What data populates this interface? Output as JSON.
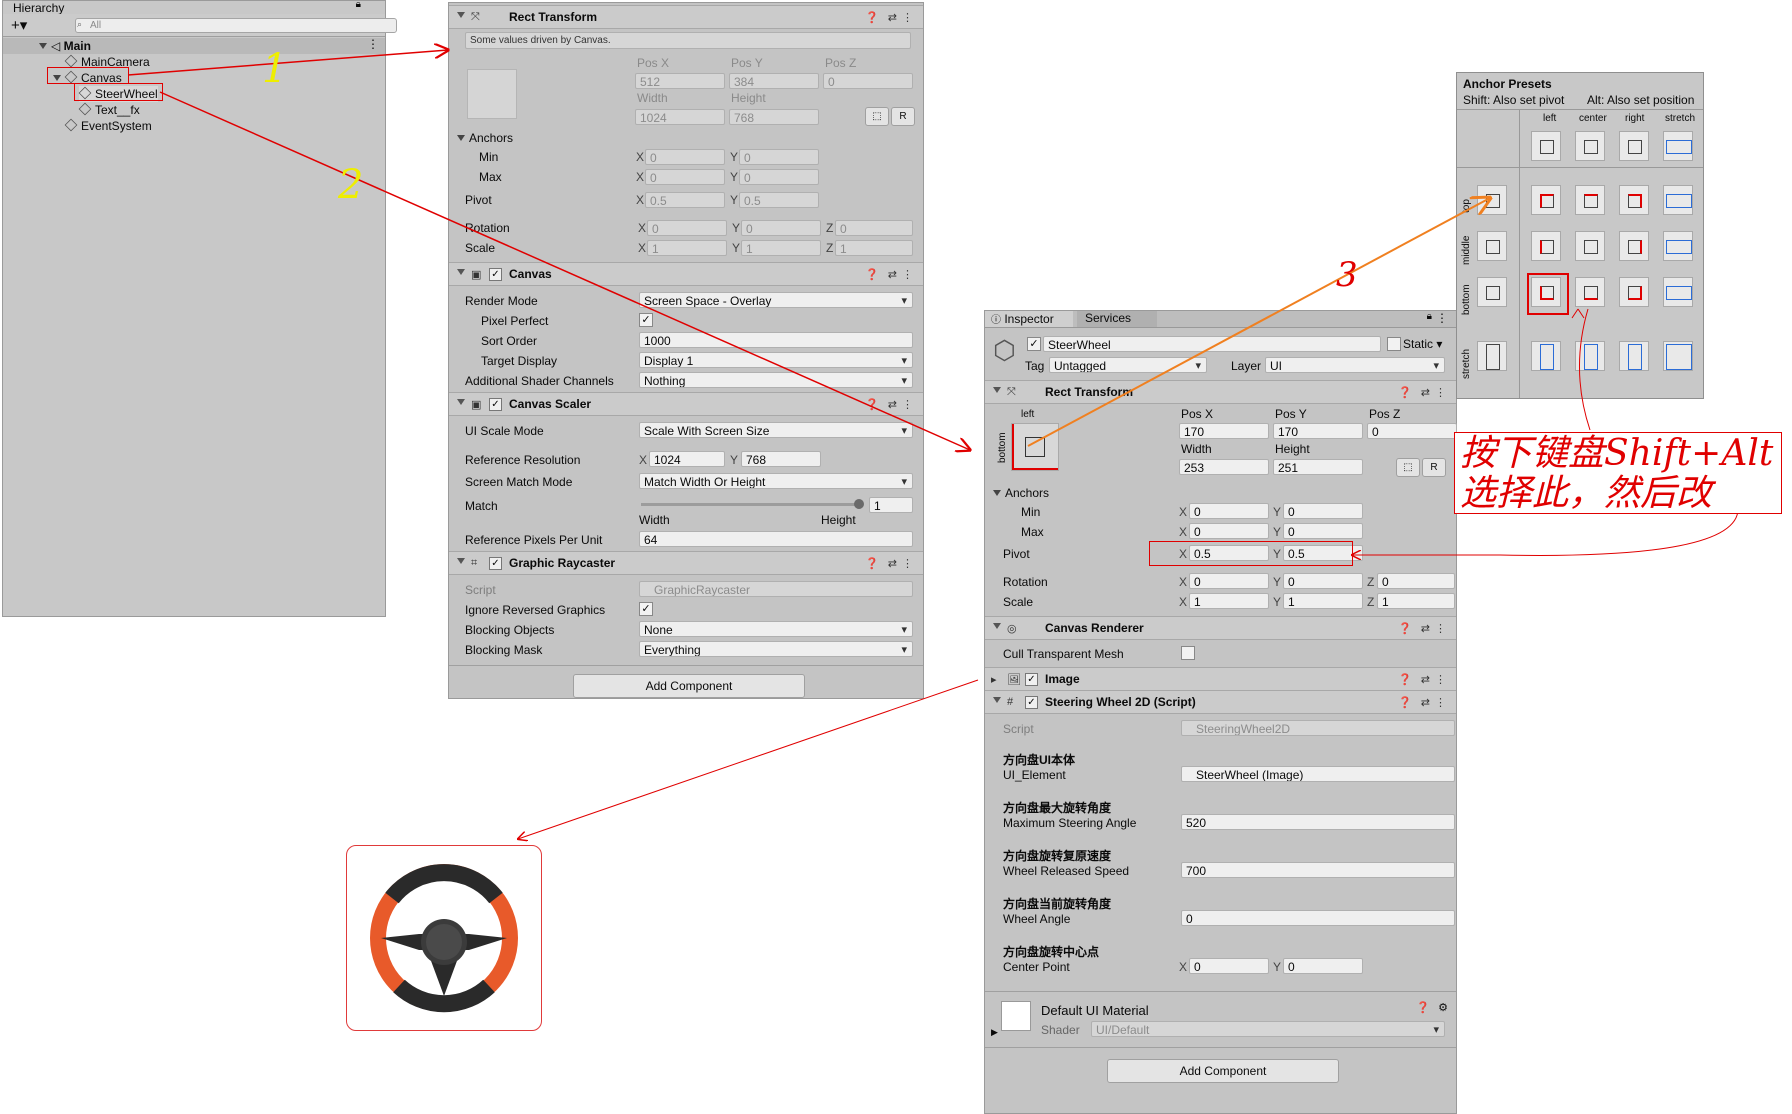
{
  "hierarchy": {
    "tab_title": "Hierarchy",
    "search_placeholder": "All",
    "items": [
      {
        "label": "Main"
      },
      {
        "label": "MainCamera"
      },
      {
        "label": "Canvas"
      },
      {
        "label": "SteerWheel"
      },
      {
        "label": "Text__fx"
      },
      {
        "label": "EventSystem"
      }
    ]
  },
  "canvas_inspector": {
    "rect_transform": {
      "title": "Rect Transform",
      "driven_note": "Some values driven by Canvas.",
      "pos_x_label": "Pos X",
      "pos_y_label": "Pos Y",
      "pos_z_label": "Pos Z",
      "pos_x": "512",
      "pos_y": "384",
      "pos_z": "0",
      "width_label": "Width",
      "height_label": "Height",
      "width": "1024",
      "height": "768",
      "anchors_label": "Anchors",
      "min_label": "Min",
      "max_label": "Max",
      "min_x": "0",
      "min_y": "0",
      "max_x": "0",
      "max_y": "0",
      "pivot_label": "Pivot",
      "pivot_x": "0.5",
      "pivot_y": "0.5",
      "rotation_label": "Rotation",
      "rot_x": "0",
      "rot_y": "0",
      "rot_z": "0",
      "scale_label": "Scale",
      "scale_x": "1",
      "scale_y": "1",
      "scale_z": "1",
      "r_label": "R"
    },
    "canvas": {
      "title": "Canvas",
      "render_mode_label": "Render Mode",
      "render_mode": "Screen Space - Overlay",
      "pixel_perfect_label": "Pixel Perfect",
      "sort_order_label": "Sort Order",
      "sort_order": "1000",
      "target_display_label": "Target Display",
      "target_display": "Display 1",
      "shader_channels_label": "Additional Shader Channels",
      "shader_channels": "Nothing"
    },
    "canvas_scaler": {
      "title": "Canvas Scaler",
      "ui_scale_mode_label": "UI Scale Mode",
      "ui_scale_mode": "Scale With Screen Size",
      "ref_res_label": "Reference Resolution",
      "ref_x": "1024",
      "ref_y": "768",
      "match_mode_label": "Screen Match Mode",
      "match_mode": "Match Width Or Height",
      "match_label": "Match",
      "match_value": "1",
      "match_fraction": 1,
      "width_label": "Width",
      "height_label": "Height",
      "ppu_label": "Reference Pixels Per Unit",
      "ppu": "64"
    },
    "graphic_raycaster": {
      "title": "Graphic Raycaster",
      "script_label": "Script",
      "script": "GraphicRaycaster",
      "ignore_reversed_label": "Ignore Reversed Graphics",
      "blocking_objects_label": "Blocking Objects",
      "blocking_objects": "None",
      "blocking_mask_label": "Blocking Mask",
      "blocking_mask": "Everything"
    },
    "add_component": "Add Component"
  },
  "wheel_inspector": {
    "tab_inspector": "Inspector",
    "tab_services": "Services",
    "object_name": "SteerWheel",
    "static_label": "Static",
    "tag_label": "Tag",
    "tag": "Untagged",
    "layer_label": "Layer",
    "layer": "UI",
    "rect_transform": {
      "title": "Rect Transform",
      "anchor_h": "left",
      "anchor_v": "bottom",
      "pos_x_label": "Pos X",
      "pos_y_label": "Pos Y",
      "pos_z_label": "Pos Z",
      "pos_x": "170",
      "pos_y": "170",
      "pos_z": "0",
      "width_label": "Width",
      "height_label": "Height",
      "width": "253",
      "height": "251",
      "anchors_label": "Anchors",
      "min_label": "Min",
      "max_label": "Max",
      "min_x": "0",
      "min_y": "0",
      "max_x": "0",
      "max_y": "0",
      "pivot_label": "Pivot",
      "pivot_x": "0.5",
      "pivot_y": "0.5",
      "rotation_label": "Rotation",
      "rot_x": "0",
      "rot_y": "0",
      "rot_z": "0",
      "scale_label": "Scale",
      "scale_x": "1",
      "scale_y": "1",
      "scale_z": "1",
      "r_label": "R"
    },
    "canvas_renderer": {
      "title": "Canvas Renderer",
      "cull_label": "Cull Transparent Mesh"
    },
    "image": {
      "title": "Image"
    },
    "steering": {
      "title": "Steering Wheel 2D (Script)",
      "script_label": "Script",
      "script": "SteeringWheel2D",
      "h1": "方向盘UI本体",
      "ui_element_label": "UI_Element",
      "ui_element": "SteerWheel (Image)",
      "h2": "方向盘最大旋转角度",
      "max_angle_label": "Maximum Steering Angle",
      "max_angle": "520",
      "h3": "方向盘旋转复原速度",
      "release_label": "Wheel Released Speed",
      "release": "700",
      "h4": "方向盘当前旋转角度",
      "wheel_angle_label": "Wheel Angle",
      "wheel_angle": "0",
      "h5": "方向盘旋转中心点",
      "center_label": "Center Point",
      "center_x": "0",
      "center_y": "0"
    },
    "material": {
      "name": "Default UI Material",
      "shader_label": "Shader",
      "shader": "UI/Default"
    },
    "add_component": "Add Component"
  },
  "anchor_presets": {
    "title": "Anchor Presets",
    "shift_hint": "Shift: Also set pivot",
    "alt_hint": "Alt: Also set position",
    "columns": [
      "left",
      "center",
      "right",
      "stretch"
    ],
    "rows": [
      "top",
      "middle",
      "bottom",
      "stretch"
    ]
  },
  "annotations": {
    "step1": "1",
    "step2": "2",
    "step3": "3",
    "note_line1": "按下键盘Shift+Alt",
    "note_line2": "选择此，然后改"
  },
  "colors": {
    "panel": "#c4c4c4",
    "highlight_red": "#e00000",
    "arrow_orange": "#f08020",
    "step_yellow": "#eeee00",
    "wheel_orange": "#e85a2a",
    "wheel_dark": "#2a2a2a"
  }
}
